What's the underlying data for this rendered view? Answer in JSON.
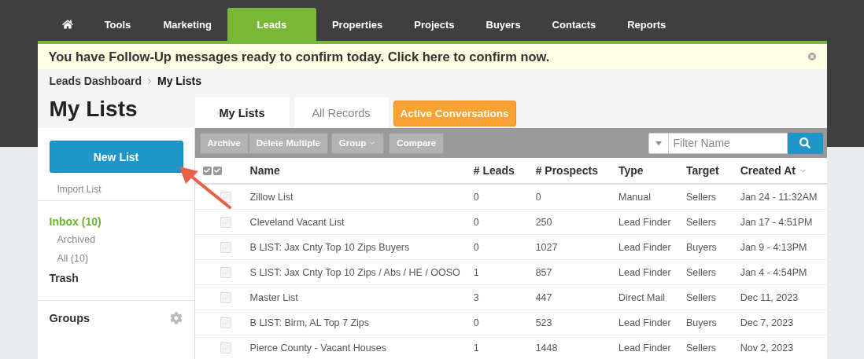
{
  "nav": {
    "items": [
      {
        "kind": "home",
        "selected": false
      },
      {
        "kind": "text",
        "label": "Tools",
        "selected": false
      },
      {
        "kind": "text",
        "label": "Marketing",
        "selected": false
      },
      {
        "kind": "text",
        "label": "Leads",
        "selected": true
      },
      {
        "kind": "text",
        "label": "Properties",
        "selected": false
      },
      {
        "kind": "text",
        "label": "Projects",
        "selected": false
      },
      {
        "kind": "text",
        "label": "Buyers",
        "selected": false
      },
      {
        "kind": "text",
        "label": "Contacts",
        "selected": false
      },
      {
        "kind": "text",
        "label": "Reports",
        "selected": false
      }
    ]
  },
  "banner": {
    "message": "You have Follow-Up messages ready to confirm today. Click here to confirm now."
  },
  "breadcrumb": [
    "Leads Dashboard",
    "My Lists"
  ],
  "page_title": "My Lists",
  "tabs": [
    {
      "label": "My Lists",
      "kind": "tab",
      "selected": true
    },
    {
      "label": "All Records",
      "kind": "tab",
      "selected": false
    },
    {
      "label": "Active Conversations",
      "kind": "action",
      "selected": false
    }
  ],
  "sidebar": {
    "new_button": "New List",
    "import_link": "Import List",
    "folders": [
      {
        "label": "Inbox (10)",
        "selected": true,
        "children": [
          {
            "label": "Archived",
            "selected": false
          },
          {
            "label": "All (10)",
            "selected": false
          }
        ]
      },
      {
        "label": "Trash",
        "selected": false
      }
    ],
    "groups_title": "Groups"
  },
  "toolbar": {
    "buttons": [
      {
        "label": "Archive",
        "kind": "joined",
        "dropdown": false
      },
      {
        "label": "Delete Multiple",
        "kind": "joined",
        "dropdown": false
      },
      {
        "label": "Group",
        "kind": "single",
        "dropdown": true
      },
      {
        "label": "Compare",
        "kind": "single",
        "dropdown": false
      }
    ],
    "filter": {
      "placeholder": "Filter Name"
    }
  },
  "table": {
    "columns": [
      {
        "label": "Name",
        "sorted": false
      },
      {
        "label": "# Leads",
        "sorted": false
      },
      {
        "label": "# Prospects",
        "sorted": false
      },
      {
        "label": "Type",
        "sorted": false
      },
      {
        "label": "Target",
        "sorted": false
      },
      {
        "label": "Created At",
        "sorted": true
      }
    ],
    "rows": [
      {
        "checked": false,
        "cells": [
          "Zillow List",
          "0",
          "0",
          "Manual",
          "Sellers",
          "Jan 24 - 11:32AM"
        ]
      },
      {
        "checked": false,
        "cells": [
          "Cleveland Vacant List",
          "0",
          "250",
          "Lead Finder",
          "Sellers",
          "Jan 17 - 4:51PM"
        ]
      },
      {
        "checked": false,
        "cells": [
          "B LIST: Jax Cnty Top 10 Zips Buyers",
          "0",
          "1027",
          "Lead Finder",
          "Buyers",
          "Jan 9 - 4:13PM"
        ]
      },
      {
        "checked": false,
        "cells": [
          "S LIST: Jax Cnty Top 10 Zips / Abs / HE / OOSO",
          "1",
          "857",
          "Lead Finder",
          "Sellers",
          "Jan 4 - 4:54PM"
        ]
      },
      {
        "checked": false,
        "cells": [
          "Master List",
          "3",
          "447",
          "Direct Mail",
          "Sellers",
          "Dec 11, 2023"
        ]
      },
      {
        "checked": false,
        "cells": [
          "B LIST: Birm, AL Top 7 Zips",
          "0",
          "523",
          "Lead Finder",
          "Buyers",
          "Dec 7, 2023"
        ]
      },
      {
        "checked": false,
        "cells": [
          "Pierce County - Vacant Houses",
          "1",
          "1448",
          "Lead Finder",
          "Sellers",
          "Nov 2, 2023"
        ]
      }
    ]
  }
}
